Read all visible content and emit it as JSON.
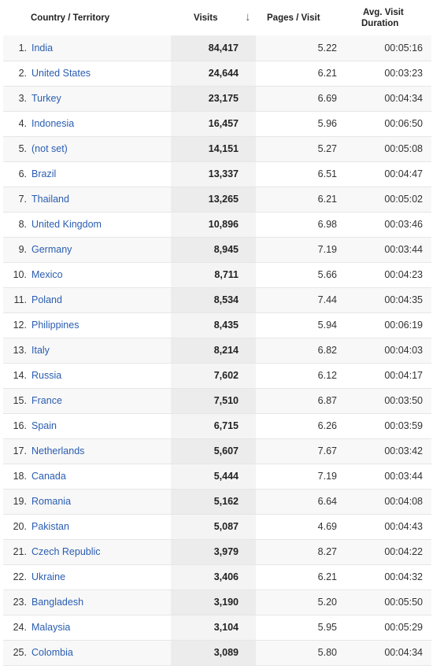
{
  "header": {
    "country": "Country / Territory",
    "visits": "Visits",
    "sort_icon": "arrow-down-icon",
    "pages": "Pages / Visit",
    "duration_line1": "Avg. Visit",
    "duration_line2": "Duration"
  },
  "rows": [
    {
      "rank": "1.",
      "country": "India",
      "visits": "84,417",
      "pages": "5.22",
      "duration": "00:05:16"
    },
    {
      "rank": "2.",
      "country": "United States",
      "visits": "24,644",
      "pages": "6.21",
      "duration": "00:03:23"
    },
    {
      "rank": "3.",
      "country": "Turkey",
      "visits": "23,175",
      "pages": "6.69",
      "duration": "00:04:34"
    },
    {
      "rank": "4.",
      "country": "Indonesia",
      "visits": "16,457",
      "pages": "5.96",
      "duration": "00:06:50"
    },
    {
      "rank": "5.",
      "country": "(not set)",
      "visits": "14,151",
      "pages": "5.27",
      "duration": "00:05:08"
    },
    {
      "rank": "6.",
      "country": "Brazil",
      "visits": "13,337",
      "pages": "6.51",
      "duration": "00:04:47"
    },
    {
      "rank": "7.",
      "country": "Thailand",
      "visits": "13,265",
      "pages": "6.21",
      "duration": "00:05:02"
    },
    {
      "rank": "8.",
      "country": "United Kingdom",
      "visits": "10,896",
      "pages": "6.98",
      "duration": "00:03:46"
    },
    {
      "rank": "9.",
      "country": "Germany",
      "visits": "8,945",
      "pages": "7.19",
      "duration": "00:03:44"
    },
    {
      "rank": "10.",
      "country": "Mexico",
      "visits": "8,711",
      "pages": "5.66",
      "duration": "00:04:23"
    },
    {
      "rank": "11.",
      "country": "Poland",
      "visits": "8,534",
      "pages": "7.44",
      "duration": "00:04:35"
    },
    {
      "rank": "12.",
      "country": "Philippines",
      "visits": "8,435",
      "pages": "5.94",
      "duration": "00:06:19"
    },
    {
      "rank": "13.",
      "country": "Italy",
      "visits": "8,214",
      "pages": "6.82",
      "duration": "00:04:03"
    },
    {
      "rank": "14.",
      "country": "Russia",
      "visits": "7,602",
      "pages": "6.12",
      "duration": "00:04:17"
    },
    {
      "rank": "15.",
      "country": "France",
      "visits": "7,510",
      "pages": "6.87",
      "duration": "00:03:50"
    },
    {
      "rank": "16.",
      "country": "Spain",
      "visits": "6,715",
      "pages": "6.26",
      "duration": "00:03:59"
    },
    {
      "rank": "17.",
      "country": "Netherlands",
      "visits": "5,607",
      "pages": "7.67",
      "duration": "00:03:42"
    },
    {
      "rank": "18.",
      "country": "Canada",
      "visits": "5,444",
      "pages": "7.19",
      "duration": "00:03:44"
    },
    {
      "rank": "19.",
      "country": "Romania",
      "visits": "5,162",
      "pages": "6.64",
      "duration": "00:04:08"
    },
    {
      "rank": "20.",
      "country": "Pakistan",
      "visits": "5,087",
      "pages": "4.69",
      "duration": "00:04:43"
    },
    {
      "rank": "21.",
      "country": "Czech Republic",
      "visits": "3,979",
      "pages": "8.27",
      "duration": "00:04:22"
    },
    {
      "rank": "22.",
      "country": "Ukraine",
      "visits": "3,406",
      "pages": "6.21",
      "duration": "00:04:32"
    },
    {
      "rank": "23.",
      "country": "Bangladesh",
      "visits": "3,190",
      "pages": "5.20",
      "duration": "00:05:50"
    },
    {
      "rank": "24.",
      "country": "Malaysia",
      "visits": "3,104",
      "pages": "5.95",
      "duration": "00:05:29"
    },
    {
      "rank": "25.",
      "country": "Colombia",
      "visits": "3,089",
      "pages": "5.80",
      "duration": "00:04:34"
    }
  ]
}
